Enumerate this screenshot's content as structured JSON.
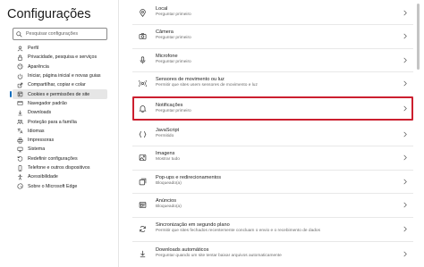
{
  "app": {
    "title": "Configurações"
  },
  "search": {
    "placeholder": "Pesquisar configurações"
  },
  "sidebar": {
    "items": [
      {
        "label": "Perfil",
        "icon": "profile-icon"
      },
      {
        "label": "Privacidade, pesquisa e serviços",
        "icon": "lock-icon"
      },
      {
        "label": "Aparência",
        "icon": "appearance-icon"
      },
      {
        "label": "Iniciar, página inicial e novas guias",
        "icon": "power-icon"
      },
      {
        "label": "Compartilhar, copiar e colar",
        "icon": "share-icon"
      },
      {
        "label": "Cookies e permissões de site",
        "icon": "cookies-icon",
        "active": true
      },
      {
        "label": "Navegador padrão",
        "icon": "browser-icon"
      },
      {
        "label": "Downloads",
        "icon": "download-icon"
      },
      {
        "label": "Proteção para a família",
        "icon": "family-icon"
      },
      {
        "label": "Idiomas",
        "icon": "languages-icon"
      },
      {
        "label": "Impressoras",
        "icon": "printer-icon"
      },
      {
        "label": "Sistema",
        "icon": "system-icon"
      },
      {
        "label": "Redefinir configurações",
        "icon": "reset-icon"
      },
      {
        "label": "Telefone e outros dispositivos",
        "icon": "phone-icon"
      },
      {
        "label": "Acessibilidade",
        "icon": "accessibility-icon"
      },
      {
        "label": "Sobre o Microsoft Edge",
        "icon": "edge-icon"
      }
    ]
  },
  "permissions": [
    {
      "title": "Local",
      "subtitle": "Perguntar primeiro",
      "icon": "location-icon"
    },
    {
      "title": "Câmera",
      "subtitle": "Perguntar primeiro",
      "icon": "camera-icon"
    },
    {
      "title": "Microfone",
      "subtitle": "Perguntar primeiro",
      "icon": "microphone-icon"
    },
    {
      "title": "Sensores de movimento ou luz",
      "subtitle": "Permitir que sites usem sensores de movimento e luz",
      "icon": "sensors-icon"
    },
    {
      "title": "Notificações",
      "subtitle": "Perguntar primeiro",
      "icon": "bell-icon",
      "highlighted": true
    },
    {
      "title": "JavaScript",
      "subtitle": "Permitido",
      "icon": "javascript-icon"
    },
    {
      "title": "Imagens",
      "subtitle": "Mostrar tudo",
      "icon": "image-icon"
    },
    {
      "title": "Pop-ups e redirecionamentos",
      "subtitle": "Bloqueado(a)",
      "icon": "popup-icon"
    },
    {
      "title": "Anúncios",
      "subtitle": "Bloqueado(a)",
      "icon": "ads-icon"
    },
    {
      "title": "Sincronização em segundo plano",
      "subtitle": "Permitir que sites fechados recentemente concluam o envio e o recebimento de dados",
      "icon": "sync-icon"
    },
    {
      "title": "Downloads automáticos",
      "subtitle": "Perguntar quando um site tentar baixar arquivos automaticamente",
      "icon": "download-icon"
    }
  ],
  "colors": {
    "accent": "#0f6cbd",
    "highlight_border": "#cc1f2f",
    "active_bg": "#e6e6e6"
  }
}
